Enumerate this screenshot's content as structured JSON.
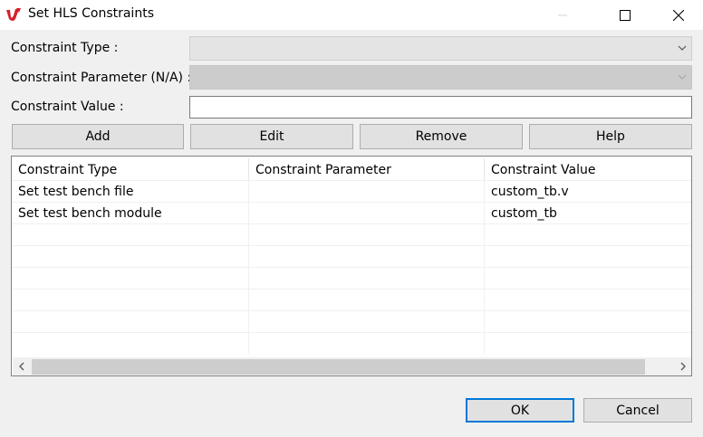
{
  "window": {
    "title": "Set HLS Constraints",
    "logo_color": "#d4212c",
    "controls": [
      "minimize-icon",
      "maximize-icon",
      "close-icon"
    ]
  },
  "form": {
    "type_label": "Constraint Type :",
    "type_value": "",
    "param_label": "Constraint Parameter (N/A) :",
    "param_value": "",
    "value_label": "Constraint Value :",
    "value_value": ""
  },
  "actions": {
    "add": "Add",
    "edit": "Edit",
    "remove": "Remove",
    "help": "Help"
  },
  "table": {
    "columns": [
      "Constraint Type",
      "Constraint Parameter",
      "Constraint Value"
    ],
    "rows": [
      [
        "Set test bench file",
        "",
        "custom_tb.v"
      ],
      [
        "Set test bench module",
        "",
        "custom_tb"
      ]
    ]
  },
  "footer": {
    "ok": "OK",
    "cancel": "Cancel",
    "ok_border_color": "#0078d7"
  }
}
